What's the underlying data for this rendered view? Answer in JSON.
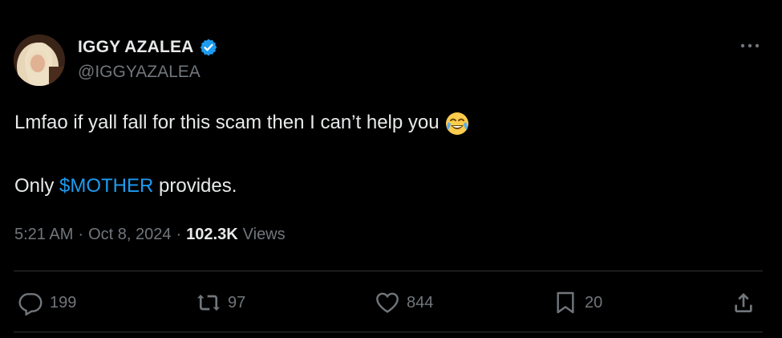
{
  "author": {
    "display_name": "IGGY AZALEA",
    "handle": "@IGGYAZALEA",
    "verified": true
  },
  "tweet": {
    "text_line1": "Lmfao if yall fall for this scam then I can’t help you",
    "emoji": "face-with-tears-of-joy",
    "text_line2_prefix": "Only ",
    "cashtag": "$MOTHER",
    "text_line2_suffix": " provides."
  },
  "meta": {
    "time": "5:21 AM",
    "sep1": "·",
    "date": "Oct 8, 2024",
    "sep2": "·",
    "views_count": "102.3K",
    "views_label": "Views"
  },
  "actions": {
    "replies": "199",
    "reposts": "97",
    "likes": "844",
    "bookmarks": "20"
  },
  "colors": {
    "background": "#000000",
    "text": "#e7e9ea",
    "muted": "#71767b",
    "accent": "#1d9bf0",
    "divider": "#2f3336"
  }
}
